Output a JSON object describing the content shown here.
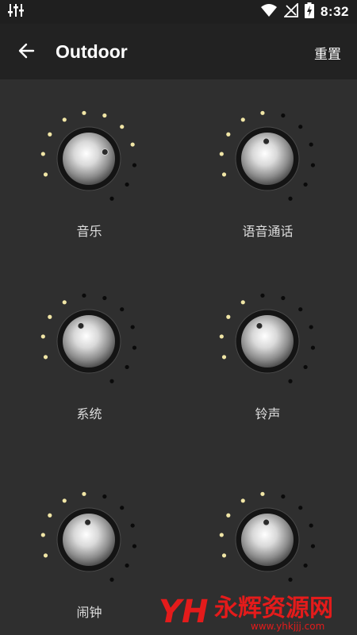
{
  "status_bar": {
    "time": "8:32",
    "icons": [
      "equalizer-icon",
      "wifi-icon",
      "no-signal-icon",
      "battery-charging-icon"
    ]
  },
  "app_bar": {
    "back_icon": "arrow-left-icon",
    "title": "Outdoor",
    "reset_label": "重置"
  },
  "knobs": [
    {
      "label": "音乐",
      "level": 8,
      "total": 11
    },
    {
      "label": "语音通话",
      "level": 5,
      "total": 11
    },
    {
      "label": "系统",
      "level": 4,
      "total": 11
    },
    {
      "label": "铃声",
      "level": 4,
      "total": 11
    },
    {
      "label": "闹钟",
      "level": 5,
      "total": 11
    },
    {
      "label": "",
      "level": 5,
      "total": 11
    }
  ],
  "watermark": {
    "logo_text": "YH",
    "brand_text": "永辉资源网",
    "url_text": "www.yhkjjj.com"
  },
  "colors": {
    "background": "#2f2f2f",
    "app_bar": "#222222",
    "dot_on": "#f1e6a6",
    "dot_off": "#0a0a0a",
    "watermark_red": "#e41b1b"
  }
}
